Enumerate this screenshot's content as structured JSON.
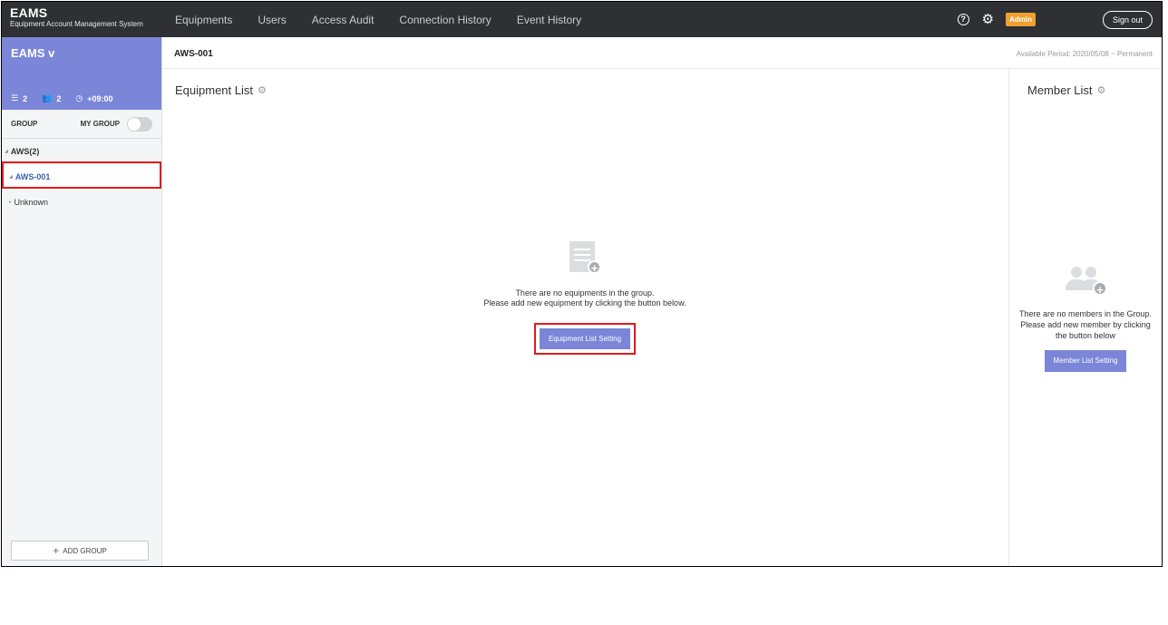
{
  "app": {
    "name": "EAMS",
    "subtitle": "Equipment Account Management System"
  },
  "nav": {
    "items": [
      "Equipments",
      "Users",
      "Access Audit",
      "Connection History",
      "Event History"
    ],
    "admin_badge": "Admin",
    "signout": "Sign out",
    "help_icon": "?"
  },
  "sidebar": {
    "title": "EAMS v",
    "stats": {
      "groups": "2",
      "users": "2",
      "timezone": "+09:00"
    },
    "group_label": "GROUP",
    "my_group_label": "MY GROUP",
    "tree": {
      "root": "AWS(2)",
      "items": [
        "AWS-001",
        "Unknown"
      ]
    },
    "add_group": "ADD GROUP"
  },
  "main": {
    "breadcrumb": "AWS-001",
    "available_period": "Available Period: 2020/05/08 ~ Permanent",
    "equipment": {
      "title": "Equipment List",
      "empty_line1": "There are no equipments in the group.",
      "empty_line2": "Please add new equipment by clicking the button below.",
      "button": "Equipment List Setting"
    },
    "member": {
      "title": "Member List",
      "empty_line1": "There are no members in the Group.",
      "empty_line2": "Please add new member by clicking",
      "empty_line3": "the button below",
      "button": "Member List Setting"
    }
  },
  "colors": {
    "topbar": "#2e3033",
    "accent": "#7b86d9",
    "admin": "#f0a030",
    "highlight": "#e21b1b",
    "active_item": "#3d62b3"
  }
}
